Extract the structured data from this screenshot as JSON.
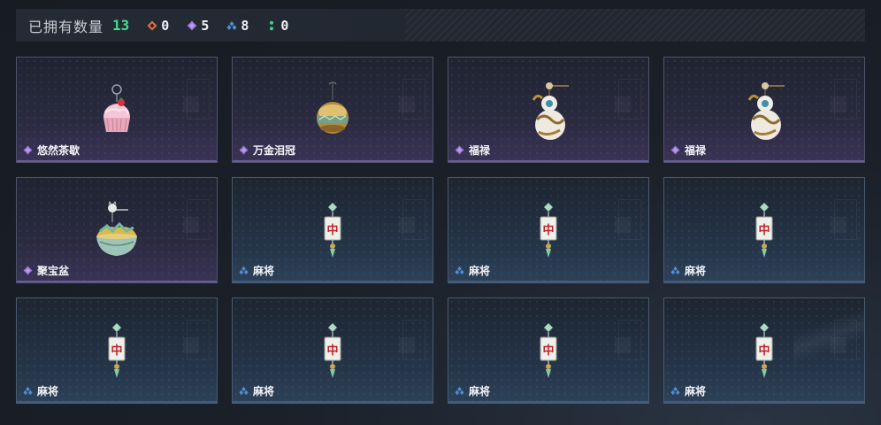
{
  "header": {
    "owned_label": "已拥有数量",
    "owned_count": "13",
    "rarities": [
      {
        "name": "orange-rarity-icon",
        "color": "#d9703f",
        "count": "0"
      },
      {
        "name": "purple-rarity-icon",
        "color": "#9a7ad8",
        "count": "5"
      },
      {
        "name": "blue-rarity-icon",
        "color": "#4f8fd8",
        "count": "8"
      },
      {
        "name": "green-rarity-icon",
        "color": "#3fcf8e",
        "count": "0"
      }
    ]
  },
  "colors": {
    "purple_rarity": "#9a7ad8",
    "blue_rarity": "#4f8fd8",
    "owned_count": "#3ee08a"
  },
  "items": [
    {
      "name": "悠然茶歇",
      "rarity": "purple",
      "icon": "cupcake-charm-icon"
    },
    {
      "name": "万金泪冠",
      "rarity": "purple",
      "icon": "golden-crown-charm-icon"
    },
    {
      "name": "福禄",
      "rarity": "purple",
      "icon": "gourd-charm-icon"
    },
    {
      "name": "福禄",
      "rarity": "purple",
      "icon": "gourd-charm-icon"
    },
    {
      "name": "聚宝盆",
      "rarity": "purple",
      "icon": "treasure-bowl-charm-icon"
    },
    {
      "name": "麻将",
      "rarity": "blue",
      "icon": "mahjong-tile-charm-icon"
    },
    {
      "name": "麻将",
      "rarity": "blue",
      "icon": "mahjong-tile-charm-icon"
    },
    {
      "name": "麻将",
      "rarity": "blue",
      "icon": "mahjong-tile-charm-icon"
    },
    {
      "name": "麻将",
      "rarity": "blue",
      "icon": "mahjong-tile-charm-icon"
    },
    {
      "name": "麻将",
      "rarity": "blue",
      "icon": "mahjong-tile-charm-icon"
    },
    {
      "name": "麻将",
      "rarity": "blue",
      "icon": "mahjong-tile-charm-icon"
    },
    {
      "name": "麻将",
      "rarity": "blue",
      "icon": "mahjong-tile-charm-icon"
    }
  ],
  "mahjong_tile_char": "中"
}
